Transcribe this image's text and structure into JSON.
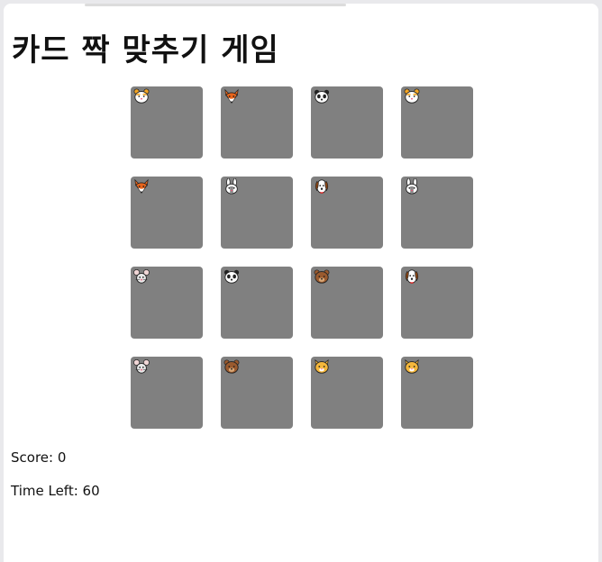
{
  "game": {
    "title": "카드 짝 맞추기 게임",
    "score_text": "Score: 0",
    "time_text": "Time Left: 60",
    "card_back_color": "#808080"
  },
  "cards": [
    {
      "animal": "hamster-icon"
    },
    {
      "animal": "fox-icon"
    },
    {
      "animal": "panda-icon"
    },
    {
      "animal": "hamster-icon"
    },
    {
      "animal": "fox-icon"
    },
    {
      "animal": "rabbit-icon"
    },
    {
      "animal": "dog-icon"
    },
    {
      "animal": "rabbit-icon"
    },
    {
      "animal": "mouse-icon"
    },
    {
      "animal": "panda-icon"
    },
    {
      "animal": "bear-icon"
    },
    {
      "animal": "dog-icon"
    },
    {
      "animal": "mouse-icon"
    },
    {
      "animal": "bear-icon"
    },
    {
      "animal": "cat-icon"
    },
    {
      "animal": "cat-icon"
    }
  ]
}
